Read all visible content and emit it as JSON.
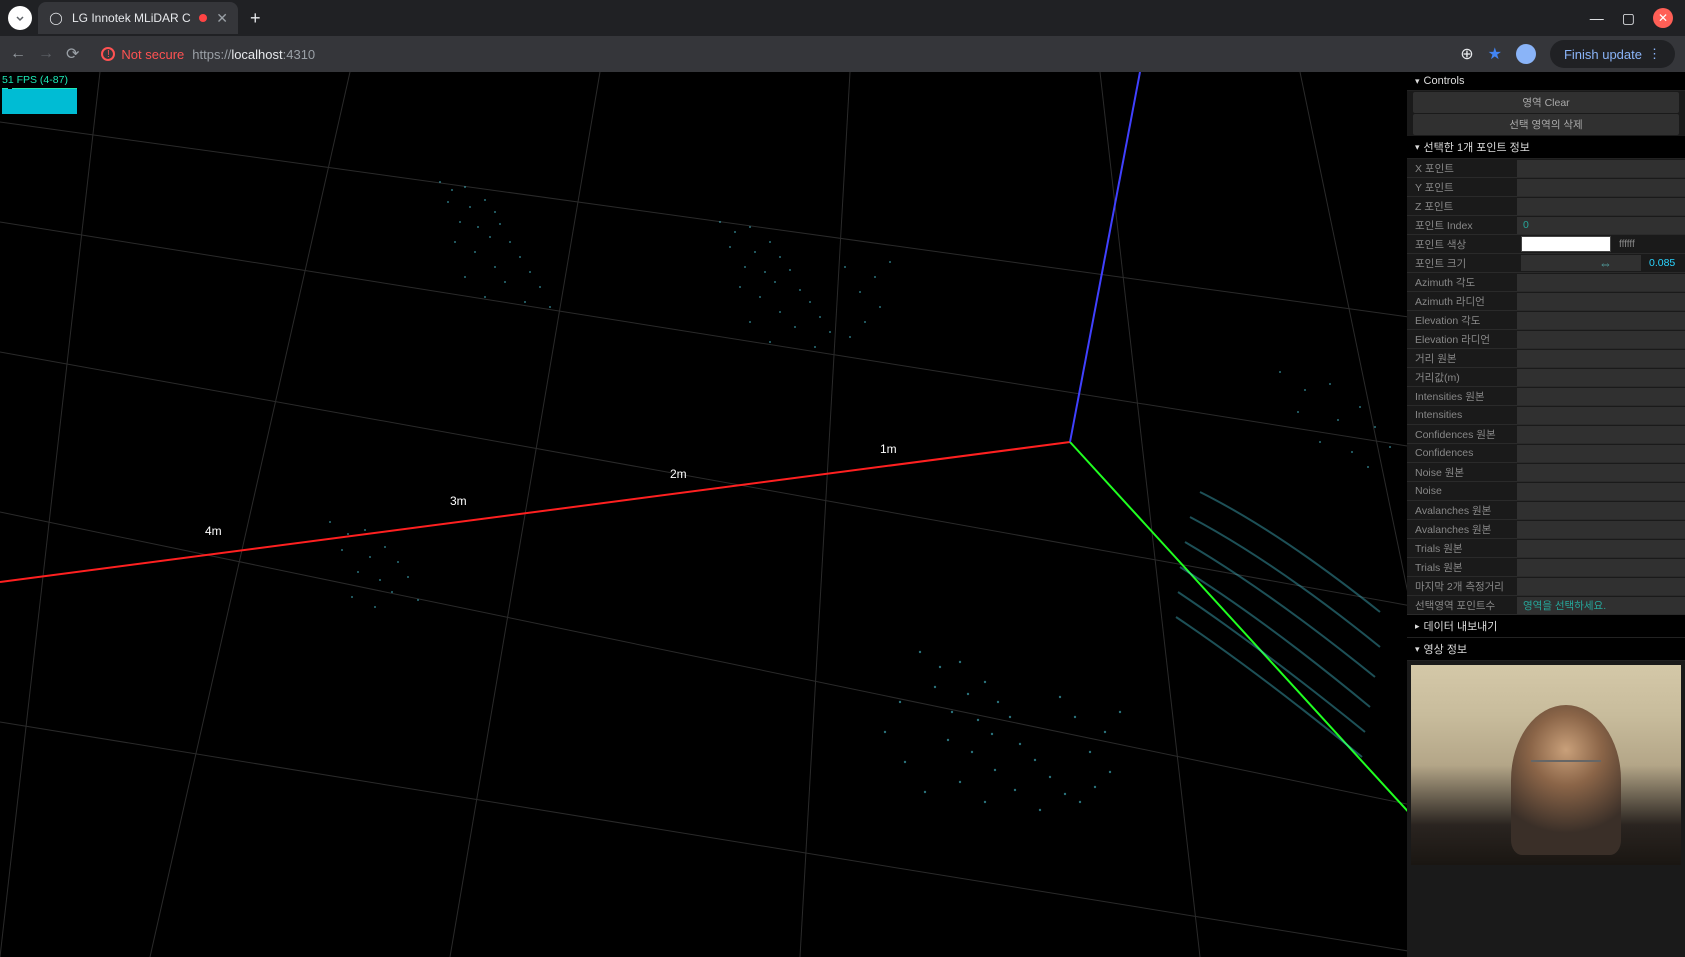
{
  "browser": {
    "tab_title": "LG Innotek MLiDAR C",
    "not_secure_label": "Not secure",
    "url_prefix": "https://",
    "url_host": "localhost",
    "url_port": ":4310",
    "finish_update": "Finish update"
  },
  "fps": {
    "text": "51 FPS (4-87)"
  },
  "axis_labels": {
    "m1": "1m",
    "m2": "2m",
    "m3": "3m",
    "m4": "4m"
  },
  "controls": {
    "header": "Controls",
    "buttons_top": [
      "영역 Clear",
      "선택 영역의 삭제"
    ],
    "section_point_info": "선택한 1개 포인트 정보",
    "rows": [
      {
        "label": "X 포인트",
        "value": ""
      },
      {
        "label": "Y 포인트",
        "value": ""
      },
      {
        "label": "Z 포인트",
        "value": ""
      },
      {
        "label": "포인트 Index",
        "value": "0",
        "cls": "val-green"
      },
      {
        "label": "포인트 색상",
        "type": "color",
        "hex": "ffffff"
      },
      {
        "label": "포인트 크기",
        "type": "slider",
        "value": "0.085"
      },
      {
        "label": "Azimuth 각도",
        "value": ""
      },
      {
        "label": "Azimuth 라디언",
        "value": ""
      },
      {
        "label": "Elevation 각도",
        "value": ""
      },
      {
        "label": "Elevation 라디언",
        "value": ""
      },
      {
        "label": "거리 원본",
        "value": ""
      },
      {
        "label": "거리값(m)",
        "value": ""
      },
      {
        "label": "Intensities 원본",
        "value": ""
      },
      {
        "label": "Intensities",
        "value": ""
      },
      {
        "label": "Confidences 원본",
        "value": ""
      },
      {
        "label": "Confidences",
        "value": ""
      },
      {
        "label": "Noise 원본",
        "value": ""
      },
      {
        "label": "Noise",
        "value": ""
      },
      {
        "label": "Avalanches 원본",
        "value": ""
      },
      {
        "label": "Avalanches 원본",
        "value": ""
      },
      {
        "label": "Trials 원본",
        "value": ""
      },
      {
        "label": "Trials 원본",
        "value": ""
      }
    ],
    "footer_rows": [
      {
        "label": "마지막 2개 측정거리",
        "value": ""
      },
      {
        "label": "선택영역 포인트수",
        "value": "영역을 선택하세요.",
        "link": true
      }
    ],
    "section_export": "데이터 내보내기",
    "section_video": "영상 정보"
  }
}
